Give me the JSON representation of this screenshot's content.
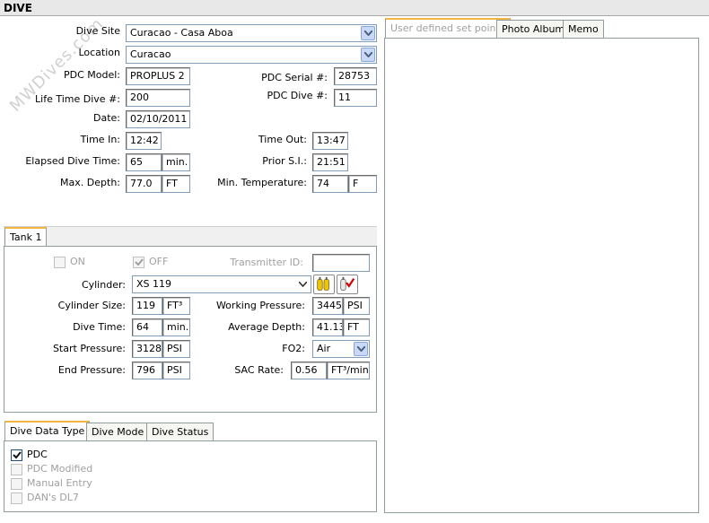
{
  "header": {
    "title": "DIVE"
  },
  "watermark": "MWDives.com",
  "dive": {
    "site_label": "Dive Site",
    "site_value": "Curacao - Casa Aboa",
    "location_label": "Location",
    "location_value": "Curacao",
    "pdc_model_label": "PDC Model:",
    "pdc_model_value": "PROPLUS 2",
    "pdc_serial_label": "PDC Serial #:",
    "pdc_serial_value": "28753",
    "lifetime_label": "Life Time Dive #:",
    "lifetime_value": "200",
    "pdc_dive_label": "PDC Dive #:",
    "pdc_dive_value": "11",
    "date_label": "Date:",
    "date_value": "02/10/2011",
    "time_in_label": "Time In:",
    "time_in_value": "12:42",
    "time_out_label": "Time Out:",
    "time_out_value": "13:47",
    "elapsed_label": "Elapsed Dive Time:",
    "elapsed_value": "65",
    "elapsed_unit": "min.",
    "prior_si_label": "Prior S.I.:",
    "prior_si_value": "21:51",
    "max_depth_label": "Max. Depth:",
    "max_depth_value": "77.0",
    "max_depth_unit": "FT",
    "min_temp_label": "Min. Temperature:",
    "min_temp_value": "74",
    "min_temp_unit": "F"
  },
  "tank": {
    "tab_label": "Tank 1",
    "on_label": "ON",
    "off_label": "OFF",
    "transmitter_label": "Transmitter ID:",
    "transmitter_value": "",
    "cylinder_label": "Cylinder:",
    "cylinder_value": "XS 119",
    "cyl_size_label": "Cylinder Size:",
    "cyl_size_value": "119",
    "cyl_size_unit": "FT³",
    "working_pressure_label": "Working Pressure:",
    "working_pressure_value": "3445",
    "working_pressure_unit": "PSI",
    "dive_time_label": "Dive Time:",
    "dive_time_value": "64",
    "dive_time_unit": "min.",
    "avg_depth_label": "Average Depth:",
    "avg_depth_value": "41.13",
    "avg_depth_unit": "FT",
    "start_pressure_label": "Start Pressure:",
    "start_pressure_value": "3128",
    "start_pressure_unit": "PSI",
    "fo2_label": "FO2:",
    "fo2_value": "Air",
    "end_pressure_label": "End Pressure:",
    "end_pressure_value": "796",
    "end_pressure_unit": "PSI",
    "sac_label": "SAC Rate:",
    "sac_value": "0.56",
    "sac_unit": "FT³/min"
  },
  "data_tabs": [
    "Dive Data Type",
    "Dive Mode",
    "Dive Status"
  ],
  "data_options": [
    {
      "label": "PDC",
      "checked": true
    },
    {
      "label": "PDC Modified",
      "checked": false
    },
    {
      "label": "Manual Entry",
      "checked": false
    },
    {
      "label": "DAN's DL7",
      "checked": false
    }
  ],
  "right_tabs": [
    "User defined set points",
    "Photo Album",
    "Memo"
  ]
}
